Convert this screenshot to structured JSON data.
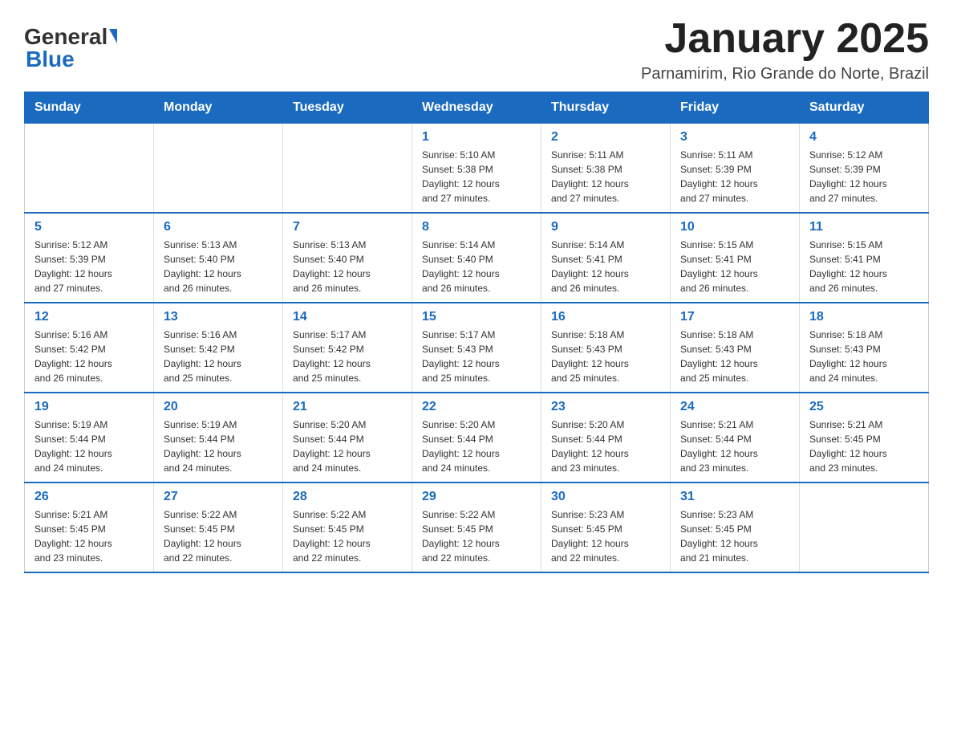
{
  "header": {
    "logo_general": "General",
    "logo_blue": "Blue",
    "month_title": "January 2025",
    "location": "Parnamirim, Rio Grande do Norte, Brazil"
  },
  "weekdays": [
    "Sunday",
    "Monday",
    "Tuesday",
    "Wednesday",
    "Thursday",
    "Friday",
    "Saturday"
  ],
  "weeks": [
    [
      {
        "day": "",
        "info": ""
      },
      {
        "day": "",
        "info": ""
      },
      {
        "day": "",
        "info": ""
      },
      {
        "day": "1",
        "info": "Sunrise: 5:10 AM\nSunset: 5:38 PM\nDaylight: 12 hours\nand 27 minutes."
      },
      {
        "day": "2",
        "info": "Sunrise: 5:11 AM\nSunset: 5:38 PM\nDaylight: 12 hours\nand 27 minutes."
      },
      {
        "day": "3",
        "info": "Sunrise: 5:11 AM\nSunset: 5:39 PM\nDaylight: 12 hours\nand 27 minutes."
      },
      {
        "day": "4",
        "info": "Sunrise: 5:12 AM\nSunset: 5:39 PM\nDaylight: 12 hours\nand 27 minutes."
      }
    ],
    [
      {
        "day": "5",
        "info": "Sunrise: 5:12 AM\nSunset: 5:39 PM\nDaylight: 12 hours\nand 27 minutes."
      },
      {
        "day": "6",
        "info": "Sunrise: 5:13 AM\nSunset: 5:40 PM\nDaylight: 12 hours\nand 26 minutes."
      },
      {
        "day": "7",
        "info": "Sunrise: 5:13 AM\nSunset: 5:40 PM\nDaylight: 12 hours\nand 26 minutes."
      },
      {
        "day": "8",
        "info": "Sunrise: 5:14 AM\nSunset: 5:40 PM\nDaylight: 12 hours\nand 26 minutes."
      },
      {
        "day": "9",
        "info": "Sunrise: 5:14 AM\nSunset: 5:41 PM\nDaylight: 12 hours\nand 26 minutes."
      },
      {
        "day": "10",
        "info": "Sunrise: 5:15 AM\nSunset: 5:41 PM\nDaylight: 12 hours\nand 26 minutes."
      },
      {
        "day": "11",
        "info": "Sunrise: 5:15 AM\nSunset: 5:41 PM\nDaylight: 12 hours\nand 26 minutes."
      }
    ],
    [
      {
        "day": "12",
        "info": "Sunrise: 5:16 AM\nSunset: 5:42 PM\nDaylight: 12 hours\nand 26 minutes."
      },
      {
        "day": "13",
        "info": "Sunrise: 5:16 AM\nSunset: 5:42 PM\nDaylight: 12 hours\nand 25 minutes."
      },
      {
        "day": "14",
        "info": "Sunrise: 5:17 AM\nSunset: 5:42 PM\nDaylight: 12 hours\nand 25 minutes."
      },
      {
        "day": "15",
        "info": "Sunrise: 5:17 AM\nSunset: 5:43 PM\nDaylight: 12 hours\nand 25 minutes."
      },
      {
        "day": "16",
        "info": "Sunrise: 5:18 AM\nSunset: 5:43 PM\nDaylight: 12 hours\nand 25 minutes."
      },
      {
        "day": "17",
        "info": "Sunrise: 5:18 AM\nSunset: 5:43 PM\nDaylight: 12 hours\nand 25 minutes."
      },
      {
        "day": "18",
        "info": "Sunrise: 5:18 AM\nSunset: 5:43 PM\nDaylight: 12 hours\nand 24 minutes."
      }
    ],
    [
      {
        "day": "19",
        "info": "Sunrise: 5:19 AM\nSunset: 5:44 PM\nDaylight: 12 hours\nand 24 minutes."
      },
      {
        "day": "20",
        "info": "Sunrise: 5:19 AM\nSunset: 5:44 PM\nDaylight: 12 hours\nand 24 minutes."
      },
      {
        "day": "21",
        "info": "Sunrise: 5:20 AM\nSunset: 5:44 PM\nDaylight: 12 hours\nand 24 minutes."
      },
      {
        "day": "22",
        "info": "Sunrise: 5:20 AM\nSunset: 5:44 PM\nDaylight: 12 hours\nand 24 minutes."
      },
      {
        "day": "23",
        "info": "Sunrise: 5:20 AM\nSunset: 5:44 PM\nDaylight: 12 hours\nand 23 minutes."
      },
      {
        "day": "24",
        "info": "Sunrise: 5:21 AM\nSunset: 5:44 PM\nDaylight: 12 hours\nand 23 minutes."
      },
      {
        "day": "25",
        "info": "Sunrise: 5:21 AM\nSunset: 5:45 PM\nDaylight: 12 hours\nand 23 minutes."
      }
    ],
    [
      {
        "day": "26",
        "info": "Sunrise: 5:21 AM\nSunset: 5:45 PM\nDaylight: 12 hours\nand 23 minutes."
      },
      {
        "day": "27",
        "info": "Sunrise: 5:22 AM\nSunset: 5:45 PM\nDaylight: 12 hours\nand 22 minutes."
      },
      {
        "day": "28",
        "info": "Sunrise: 5:22 AM\nSunset: 5:45 PM\nDaylight: 12 hours\nand 22 minutes."
      },
      {
        "day": "29",
        "info": "Sunrise: 5:22 AM\nSunset: 5:45 PM\nDaylight: 12 hours\nand 22 minutes."
      },
      {
        "day": "30",
        "info": "Sunrise: 5:23 AM\nSunset: 5:45 PM\nDaylight: 12 hours\nand 22 minutes."
      },
      {
        "day": "31",
        "info": "Sunrise: 5:23 AM\nSunset: 5:45 PM\nDaylight: 12 hours\nand 21 minutes."
      },
      {
        "day": "",
        "info": ""
      }
    ]
  ]
}
